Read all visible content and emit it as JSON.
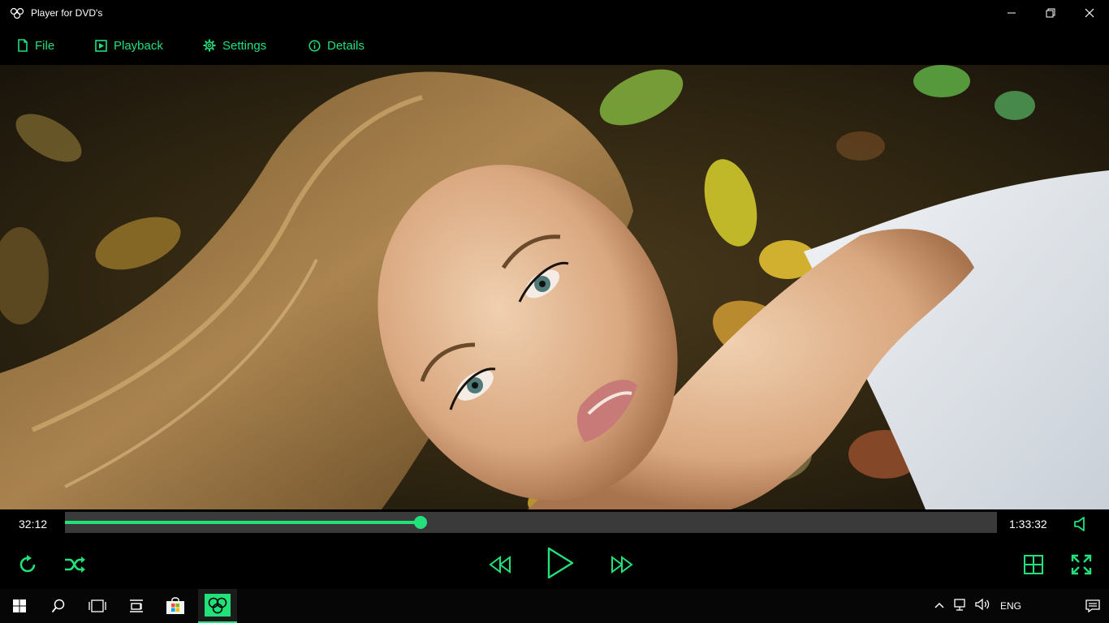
{
  "window": {
    "title": "Player for DVD's",
    "controls": [
      "minimize-icon",
      "restore-icon",
      "close-icon"
    ]
  },
  "menu": {
    "items": [
      {
        "label": "File",
        "icon": "file-icon"
      },
      {
        "label": "Playback",
        "icon": "playback-icon"
      },
      {
        "label": "Settings",
        "icon": "gear-icon"
      },
      {
        "label": "Details",
        "icon": "info-icon"
      }
    ]
  },
  "player": {
    "current_time": "32:12",
    "total_time": "1:33:32",
    "progress": 0.3815,
    "accent_color": "#22e07a",
    "track_color": "#3a3a3a"
  },
  "controls": {
    "left": [
      "repeat-icon",
      "shuffle-icon"
    ],
    "center": [
      "rewind-icon",
      "play-icon",
      "fast-forward-icon"
    ],
    "right": [
      "playlist-grid-icon",
      "fullscreen-icon"
    ]
  },
  "taskbar": {
    "items": [
      "windows-start-icon",
      "search-icon",
      "task-view-icon",
      "news-icon",
      "store-icon",
      "dvd-player-app-icon"
    ],
    "tray": [
      "chevron-up-icon",
      "network-icon",
      "speaker-icon"
    ],
    "language": "ENG"
  }
}
